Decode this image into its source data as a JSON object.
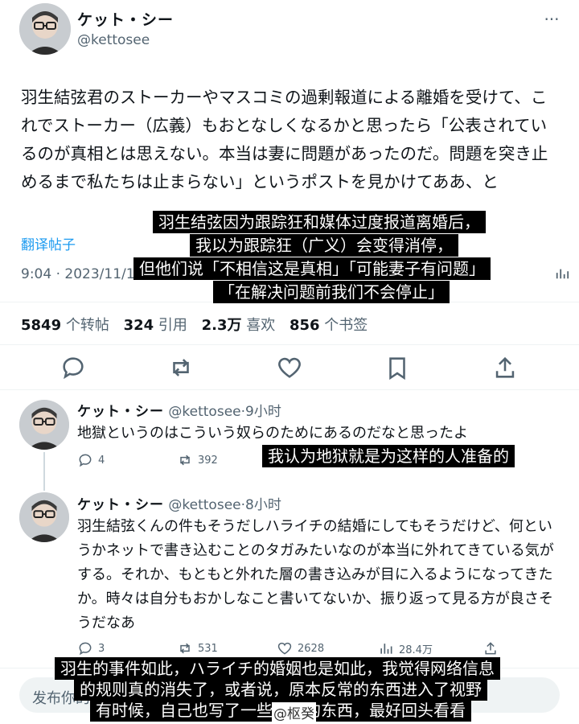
{
  "main_tweet": {
    "display_name": "ケット・シー",
    "handle": "@kettosee",
    "more_icon": "ellipsis-icon",
    "text": "羽生結弦君のストーカーやマスコミの過剰報道による離婚を受けて、これでストーカー（広義）もおとなしくなるかと思ったら「公表されているのが真相とは思えない。本当は妻に問題があったのだ。問題を突き止めるまで私たちは止まらない」というポストを見かけてああ、と",
    "translate_label": "翻译帖子",
    "timestamp": "9:04 · 2023/11/1",
    "stats": {
      "reposts_count": "5849",
      "reposts_label": "个转帖",
      "quotes_count": "324",
      "quotes_label": "引用",
      "likes_count": "2.3万",
      "likes_label": "喜欢",
      "bookmarks_count": "856",
      "bookmarks_label": "个书签"
    },
    "actions": [
      "reply-icon",
      "repost-icon",
      "like-icon",
      "bookmark-icon",
      "share-icon"
    ]
  },
  "replies": [
    {
      "display_name": "ケット・シー",
      "handle_time": "@kettosee·9小时",
      "text": "地獄というのはこういう奴らのためにあるのだなと思ったよ",
      "reply_count": "4",
      "repost_count": "392"
    },
    {
      "display_name": "ケット・シー",
      "handle_time": "@kettosee·8小时",
      "text": "羽生結弦くんの件もそうだしハライチの結婚にしてもそうだけど、何というかネットで書き込むことのタガみたいなのが本当に外れてきている気がする。それか、もともと外れた層の書き込みが目に入るようになってきたか。時々は自分もおかしなこと書いてないか、振り返って見る方が良さそうだなあ",
      "reply_count": "3",
      "repost_count": "531",
      "like_count": "2628",
      "view_count": "28.4万"
    }
  ],
  "compose": {
    "placeholder": "发布你的"
  },
  "subtitles": {
    "main": [
      "羽生结弦因为跟踪狂和媒体过度报道离婚后，",
      "我以为跟踪狂（广义）会变得消停，",
      "但他们说「不相信这是真相」「可能妻子有问题」",
      "「在解决问题前我们不会停止」"
    ],
    "reply1": [
      "我认为地狱就是为这样的人准备的"
    ],
    "reply2": [
      "羽生的事件如此，ハライチ的婚姻也是如此，我觉得网络信息",
      "的规则真的消失了，或者说，原本反常的东西进入了视野",
      "有时候，自己也写了一些奇怪的东西，最好回头看看"
    ]
  },
  "watermark": "@枢癸"
}
